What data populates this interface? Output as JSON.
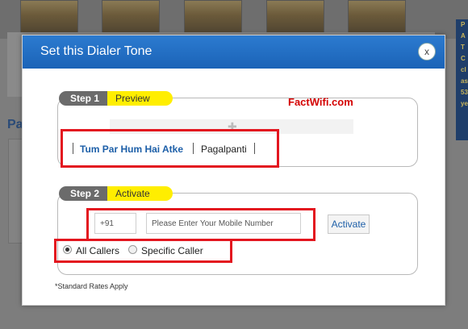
{
  "modal": {
    "title": "Set this Dialer Tone",
    "close_label": "x",
    "watermark": "FactWifi.com"
  },
  "step1": {
    "number_label": "Step 1",
    "name_label": "Preview",
    "song_title": "Tum Par Hum Hai Atke",
    "album": "Pagalpanti"
  },
  "step2": {
    "number_label": "Step 2",
    "name_label": "Activate",
    "country_code": "+91",
    "mobile_placeholder": "Please Enter Your Mobile Number",
    "activate_label": "Activate",
    "radio_all": "All Callers",
    "radio_specific": "Specific Caller",
    "selected_option": "All Callers"
  },
  "footer_note": "*Standard Rates Apply",
  "background": {
    "heading_fragment": "Pa",
    "side_text": [
      "P",
      "A",
      "T",
      "C",
      "cl",
      "as",
      "53",
      "ye"
    ]
  },
  "colors": {
    "header_blue": "#1b63b7",
    "step_yellow": "#ffee00",
    "highlight_red": "#e3161f",
    "link_blue": "#1d5fa8"
  }
}
